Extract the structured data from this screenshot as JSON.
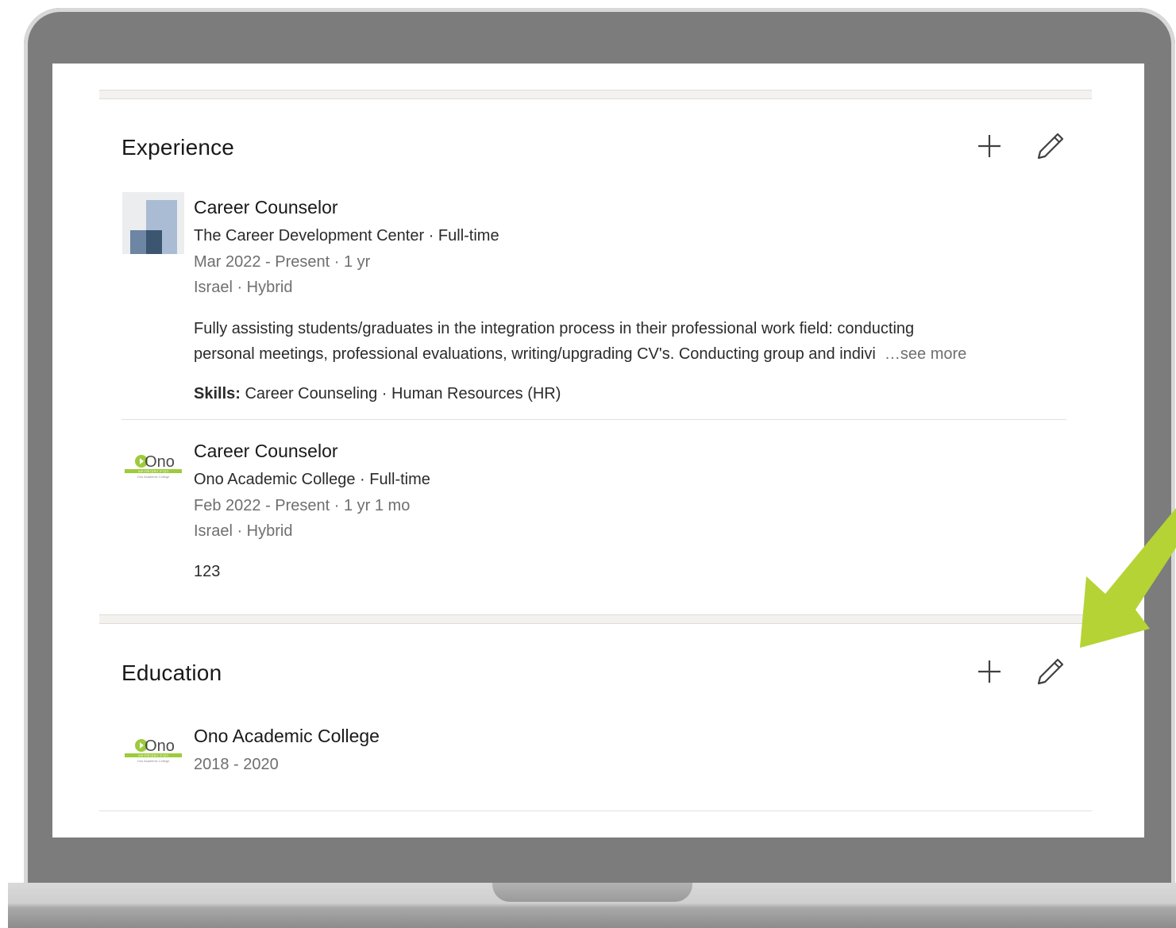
{
  "experience": {
    "title": "Experience",
    "add_icon": "plus-icon",
    "edit_icon": "pencil-icon",
    "items": [
      {
        "title": "Career Counselor",
        "company_line": "The Career Development Center · Full-time",
        "dates": "Mar 2022 - Present · 1 yr",
        "location": "Israel · Hybrid",
        "description_line1": "Fully assisting students/graduates in the integration process in their professional work field: conducting",
        "description_line2": "personal meetings, professional evaluations, writing/upgrading CV's. Conducting group and indivi",
        "see_more": "…see more",
        "skills_label": "Skills:",
        "skills": "Career Counseling · Human Resources (HR)"
      },
      {
        "title": "Career Counselor",
        "company_line": "Ono Academic College · Full-time",
        "dates": "Feb 2022 - Present · 1 yr 1 mo",
        "location": "Israel · Hybrid",
        "description": "123"
      }
    ]
  },
  "education": {
    "title": "Education",
    "items": [
      {
        "school": "Ono Academic College",
        "years": "2018 - 2020"
      }
    ]
  },
  "ono_logo": {
    "wordmark": "Ono",
    "tagline_he": "הקריה האקדמית אונו",
    "tagline_en": "Ono Academic College"
  },
  "colors": {
    "accent_arrow": "#b5d334",
    "bezel": "#7c7c7c",
    "ono_green": "#9ccb3b"
  }
}
